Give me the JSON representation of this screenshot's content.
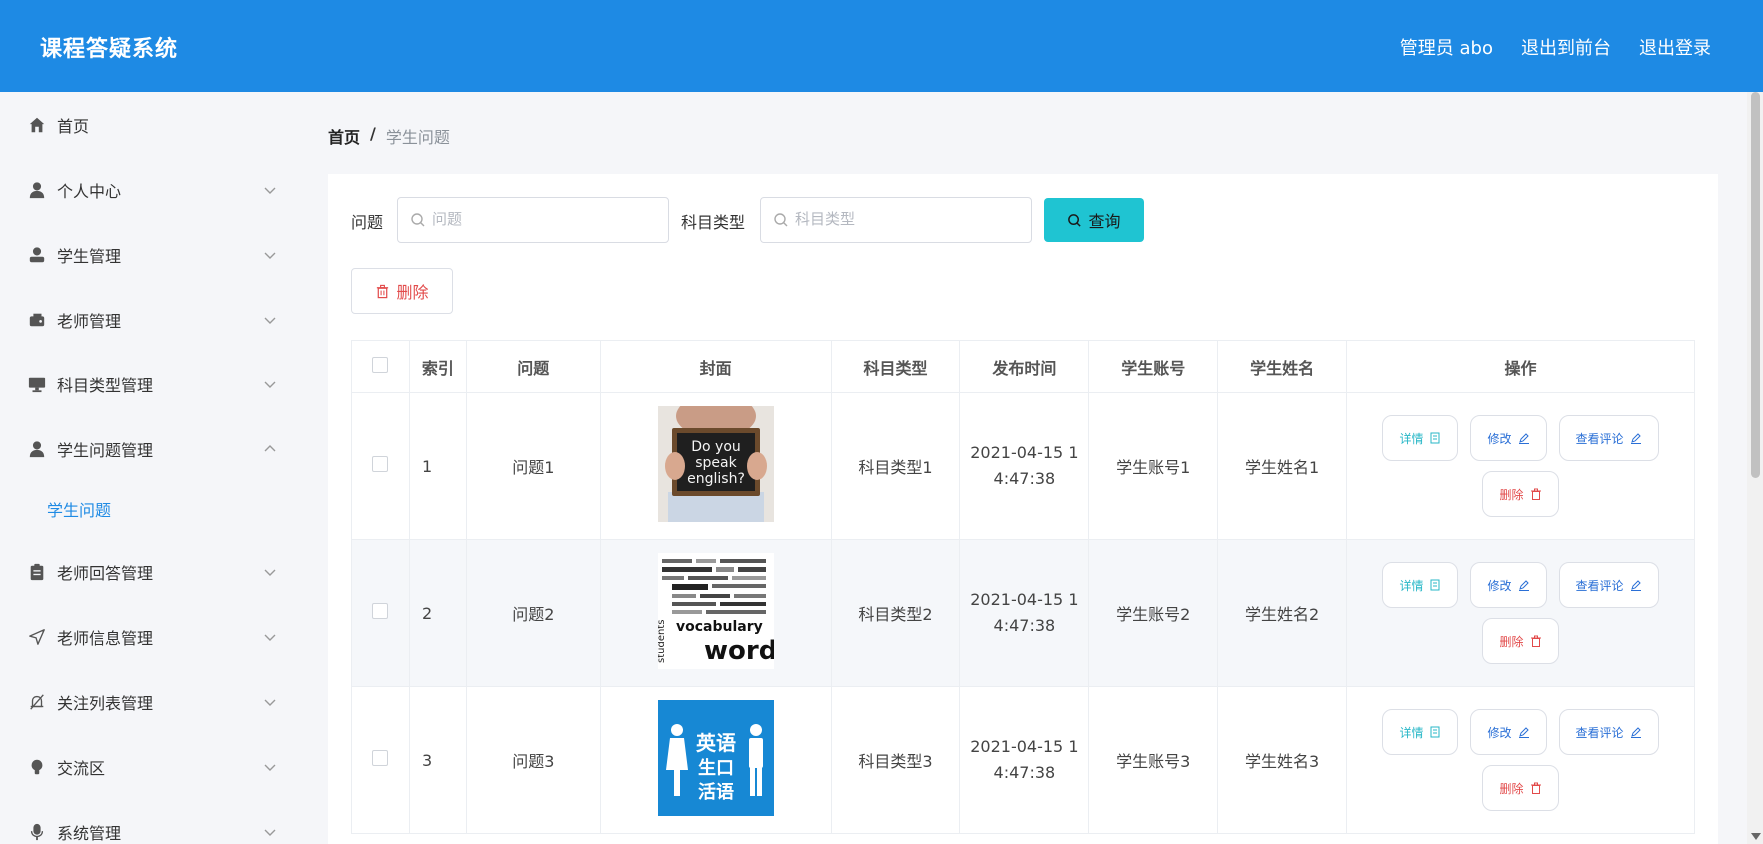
{
  "header": {
    "app_title": "课程答疑系统",
    "admin_label": "管理员 abo",
    "front_label": "退出到前台",
    "logout_label": "退出登录"
  },
  "sidebar": {
    "items": [
      {
        "label": "首页",
        "icon": "home-icon"
      },
      {
        "label": "个人中心",
        "icon": "user-icon"
      },
      {
        "label": "学生管理",
        "icon": "student-icon"
      },
      {
        "label": "老师管理",
        "icon": "wallet-icon"
      },
      {
        "label": "科目类型管理",
        "icon": "monitor-icon"
      },
      {
        "label": "学生问题管理",
        "icon": "user-icon"
      },
      {
        "label": "老师回答管理",
        "icon": "clipboard-icon"
      },
      {
        "label": "老师信息管理",
        "icon": "send-icon"
      },
      {
        "label": "关注列表管理",
        "icon": "bell-off-icon"
      },
      {
        "label": "交流区",
        "icon": "bulb-icon"
      },
      {
        "label": "系统管理",
        "icon": "microphone-icon"
      }
    ],
    "sub_item": "学生问题"
  },
  "breadcrumb": {
    "home": "首页",
    "separator": "/",
    "current": "学生问题"
  },
  "search": {
    "question_label": "问题",
    "question_placeholder": "问题",
    "subject_label": "科目类型",
    "subject_placeholder": "科目类型",
    "query_label": "查询"
  },
  "toolbar": {
    "delete_label": "删除"
  },
  "table": {
    "headers": [
      "索引",
      "问题",
      "封面",
      "科目类型",
      "发布时间",
      "学生账号",
      "学生姓名",
      "操作"
    ],
    "rows": [
      {
        "index": "1",
        "question": "问题1",
        "cover": "Do you speak english? sign",
        "subject": "科目类型1",
        "time_line1": "2021-04-15 1",
        "time_line2": "4:47:38",
        "account": "学生账号1",
        "name": "学生姓名1"
      },
      {
        "index": "2",
        "question": "问题2",
        "cover": "vocabulary words cloud",
        "subject": "科目类型2",
        "time_line1": "2021-04-15 1",
        "time_line2": "4:47:38",
        "account": "学生账号2",
        "name": "学生姓名2"
      },
      {
        "index": "3",
        "question": "问题3",
        "cover": "英语生口活语 restroom sign",
        "subject": "科目类型3",
        "time_line1": "2021-04-15 1",
        "time_line2": "4:47:38",
        "account": "学生账号3",
        "name": "学生姓名3"
      }
    ],
    "op_labels": {
      "detail": "详情",
      "edit": "修改",
      "comments": "查看评论",
      "delete": "删除"
    }
  },
  "covers": {
    "cover1": {
      "line1": "Do you",
      "line2": "speak",
      "line3": "english?"
    },
    "cover2": {
      "big1": "vocabulary",
      "big2": "words",
      "side": "students"
    },
    "cover3": {
      "line1": "英语",
      "line2": "生口",
      "line3": "活语"
    }
  },
  "colors": {
    "header_bg": "#1e8ae4",
    "query_btn": "#1fc4d2",
    "danger": "#e24a4a",
    "primary": "#2a6fd6"
  }
}
